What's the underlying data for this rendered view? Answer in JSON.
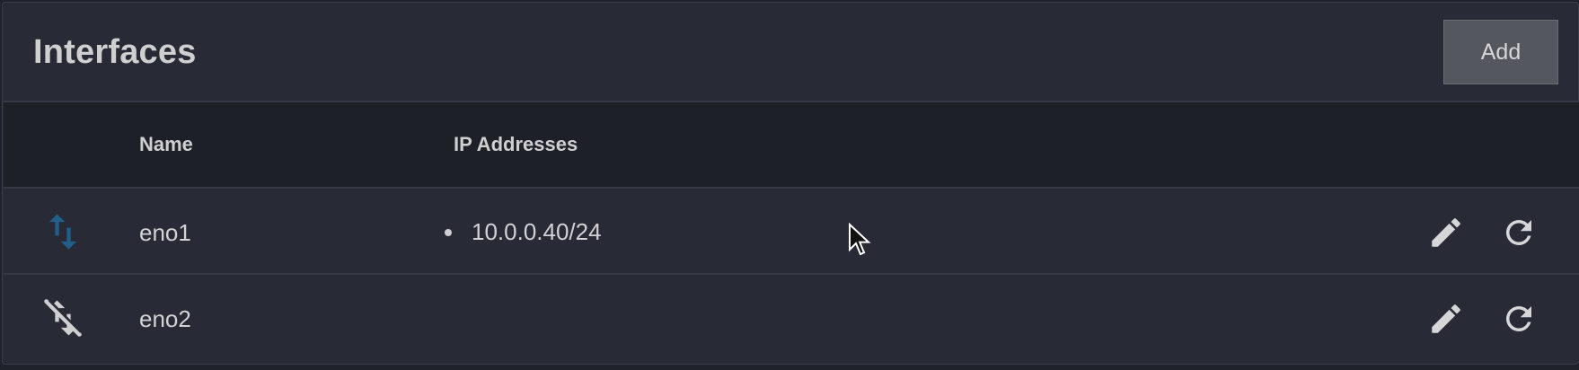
{
  "card": {
    "title": "Interfaces",
    "add_label": "Add"
  },
  "table": {
    "columns": [
      "Name",
      "IP Addresses"
    ],
    "rows": [
      {
        "status_icon": "link-up-arrows-icon",
        "status_color": "#1f5f8a",
        "name": "eno1",
        "ip_addresses": [
          "10.0.0.40/24"
        ]
      },
      {
        "status_icon": "link-down-arrows-icon",
        "status_color": "#cfcfd2",
        "name": "eno2",
        "ip_addresses": []
      }
    ]
  },
  "icons": {
    "edit": "pencil-icon",
    "refresh": "refresh-icon",
    "cursor": "mouse-pointer-icon"
  }
}
